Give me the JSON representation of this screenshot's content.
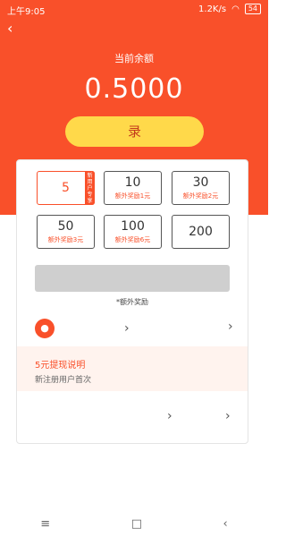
{
  "status": {
    "time": "上午9:05",
    "speed": "1.2K/s",
    "battery": "54"
  },
  "header": {
    "balance_label": "当前余额",
    "balance_value": "0.5000",
    "record_button": "录"
  },
  "amounts": [
    {
      "value": "5",
      "note": "",
      "badge": "新用户专享",
      "selected": true
    },
    {
      "value": "10",
      "note": "额外奖励1元"
    },
    {
      "value": "30",
      "note": "额外奖励2元"
    },
    {
      "value": "50",
      "note": "额外奖励3元"
    },
    {
      "value": "100",
      "note": "额外奖励6元"
    },
    {
      "value": "200",
      "note": ""
    }
  ],
  "bonus_note": "*额外奖励",
  "explain": {
    "title": "5元提现说明",
    "line1": "新注册用户首次"
  },
  "nav": {
    "menu": "≡",
    "home": "□",
    "back": "‹"
  },
  "colors": {
    "accent": "#f9502a",
    "button": "#ffd94a"
  }
}
